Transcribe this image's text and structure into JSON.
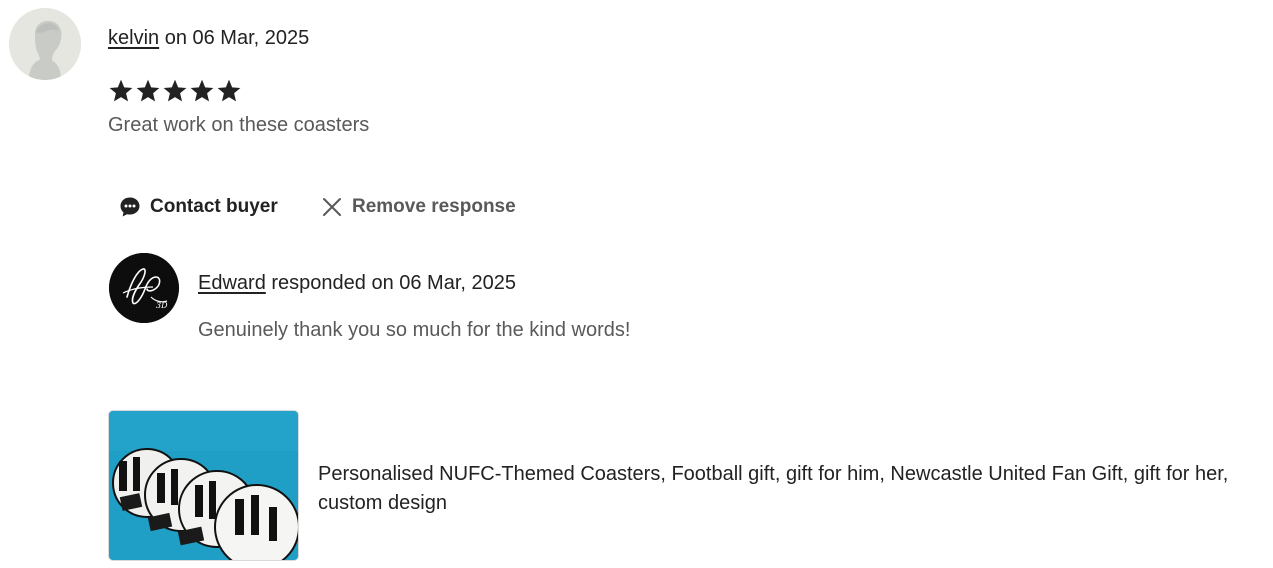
{
  "review": {
    "reviewer_name": "kelvin",
    "date_prefix": " on 06 Mar, 2025",
    "rating": 5,
    "max_rating": 5,
    "text": "Great work on these coasters"
  },
  "actions": {
    "contact_label": "Contact buyer",
    "remove_label": "Remove response"
  },
  "response": {
    "seller_name": "Edward",
    "meta_suffix": " responded on 06 Mar, 2025",
    "text": "Genuinely thank you so much for the kind words!"
  },
  "product": {
    "title": "Personalised NUFC-Themed Coasters, Football gift, gift for him, Newcastle United Fan Gift, gift for her, custom design"
  },
  "icons": {
    "reviewer_avatar": "default-user-icon",
    "star": "star-icon",
    "contact": "chat-bubble-icon",
    "remove": "close-icon",
    "seller_avatar": "signature-logo"
  },
  "colors": {
    "star_fill": "#222222",
    "primary_text": "#222222",
    "secondary_text": "#595959",
    "product_bg": "#1f9ec6"
  }
}
